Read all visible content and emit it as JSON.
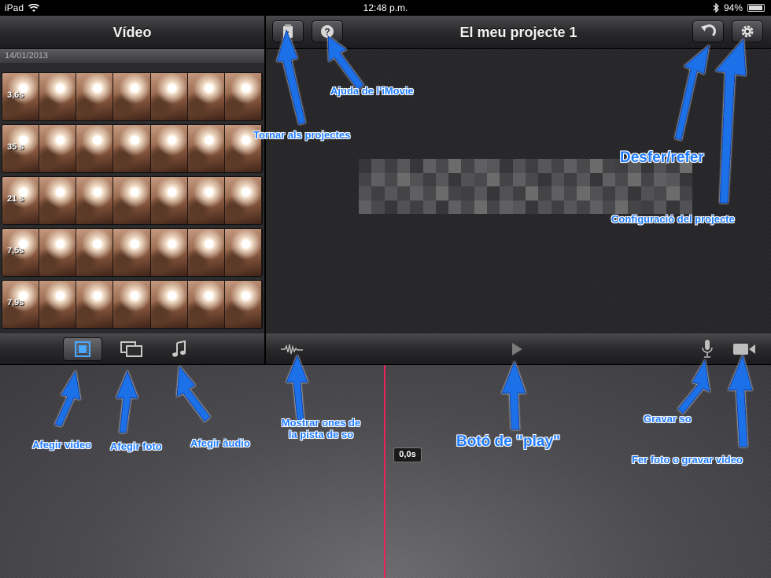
{
  "status_bar": {
    "device": "iPad",
    "time": "12:48 p.m.",
    "battery": "94%"
  },
  "media_panel": {
    "title": "Vídeo",
    "date": "14/01/2013",
    "clips": [
      {
        "duration": "3,6s"
      },
      {
        "duration": "35 s"
      },
      {
        "duration": "21 s"
      },
      {
        "duration": "7,5s"
      },
      {
        "duration": "7,9s"
      }
    ]
  },
  "project": {
    "title": "El meu projecte 1"
  },
  "timeline": {
    "time": "0,0s"
  },
  "annotations": {
    "back": "Tornar als projectes",
    "help": "Ajuda de l'iMovie",
    "undo": "Desfer/refer",
    "settings": "Configuració del projecte",
    "add_video": "Afegir vídeo",
    "add_photo": "Afegir foto",
    "add_audio": "Afegir àudio",
    "waveform_line1": "Mostrar ones de",
    "waveform_line2": "la pista de so",
    "play": "Botó de \"play\"",
    "record_audio": "Gravar so",
    "camera": "Fer foto o gravar vídeo"
  },
  "colors": {
    "annotation_blue": "#1e7bff",
    "playhead": "#e8235a",
    "active_tab_icon": "#4aa8ff"
  }
}
